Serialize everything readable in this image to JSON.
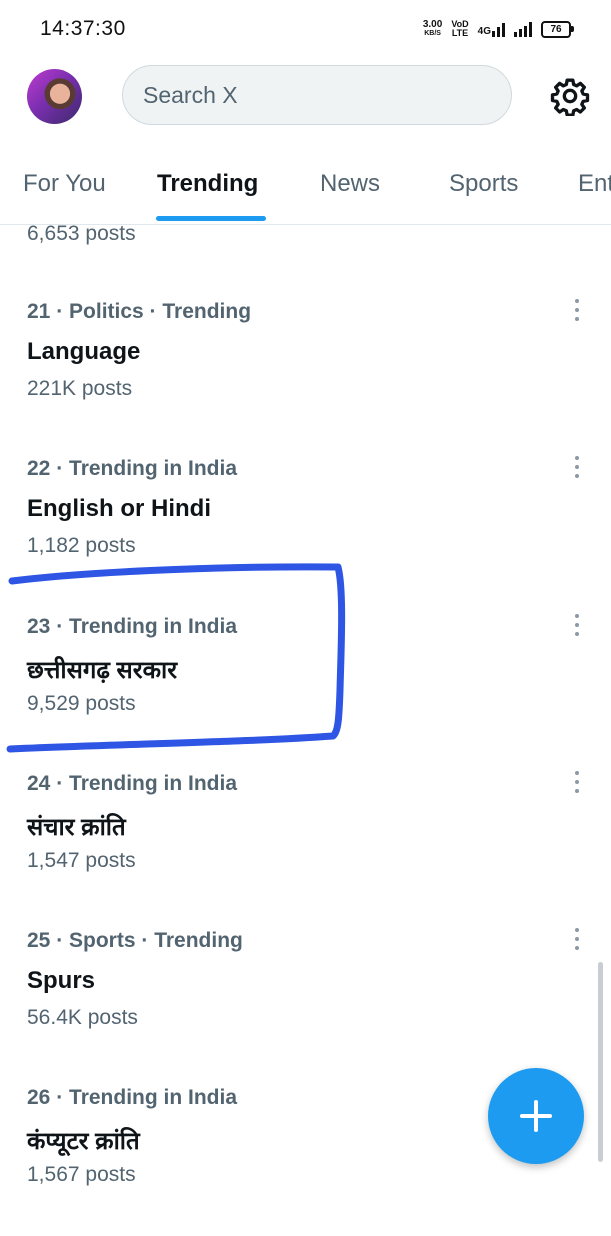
{
  "status_bar": {
    "time": "14:37:30",
    "net_speed": "3.00",
    "net_unit": "KB/S",
    "volte_top": "VoD",
    "volte_bottom": "LTE",
    "network": "4G",
    "battery": "76"
  },
  "header": {
    "search_placeholder": "Search X"
  },
  "tabs": [
    {
      "label": "For You",
      "active": false
    },
    {
      "label": "Trending",
      "active": true
    },
    {
      "label": "News",
      "active": false
    },
    {
      "label": "Sports",
      "active": false
    },
    {
      "label": "Ent",
      "active": false
    }
  ],
  "partial_post_count": "6,653 posts",
  "trends": [
    {
      "meta": "21 · Politics · Trending",
      "name": "Language",
      "posts": "221K posts"
    },
    {
      "meta": "22 · Trending in India",
      "name": "English or Hindi",
      "posts": "1,182 posts"
    },
    {
      "meta": "23 · Trending in India",
      "name": "छत्तीसगढ़ सरकार",
      "posts": "9,529 posts"
    },
    {
      "meta": "24 · Trending in India",
      "name": "संचार क्रांति",
      "posts": "1,547 posts"
    },
    {
      "meta": "25 · Sports · Trending",
      "name": "Spurs",
      "posts": "56.4K posts"
    },
    {
      "meta": "26 · Trending in India",
      "name": "कंप्यूटर क्रांति",
      "posts": "1,567 posts"
    }
  ],
  "colors": {
    "accent": "#1d9bf0",
    "highlight_marker": "#2f55e4"
  }
}
